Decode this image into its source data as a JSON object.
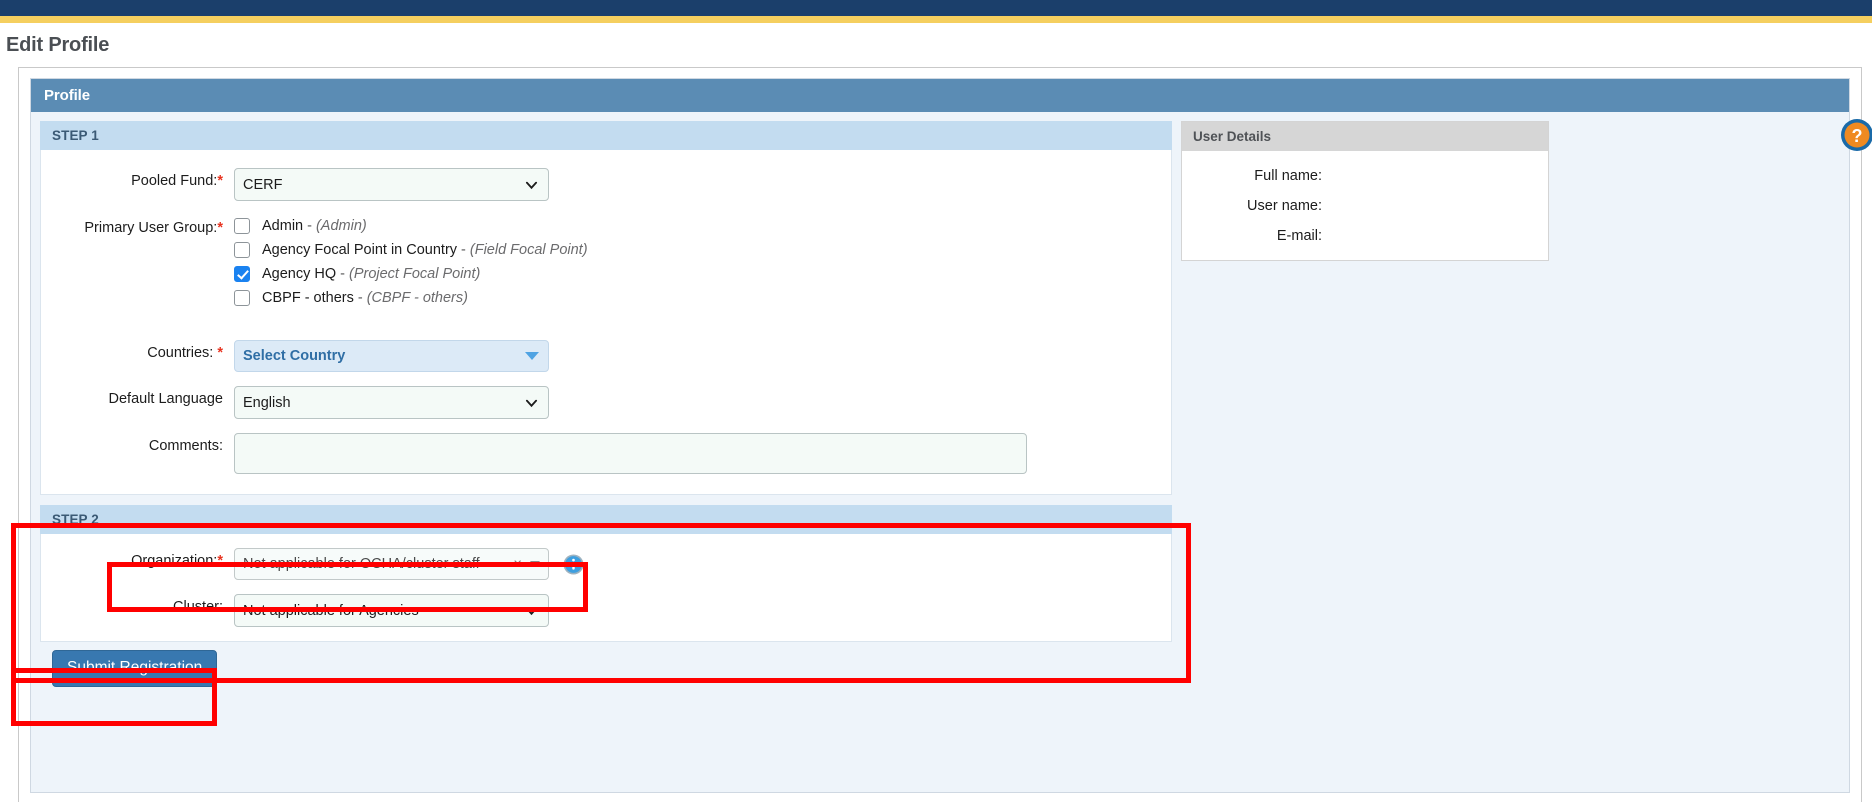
{
  "page": {
    "title": "Edit Profile"
  },
  "help": {
    "icon": "help-question-icon",
    "label": "?"
  },
  "profile_panel": {
    "header": "Profile"
  },
  "step1": {
    "header": "STEP 1",
    "pooled_fund": {
      "label": "Pooled Fund:",
      "required": "*",
      "value": "CERF",
      "options": [
        "CERF"
      ]
    },
    "primary_user_group": {
      "label": "Primary User Group:",
      "required": "*",
      "items": [
        {
          "name": "Admin",
          "dash": "-",
          "role": "(Admin)",
          "checked": false
        },
        {
          "name": "Agency Focal Point in Country",
          "dash": "-",
          "role": "(Field Focal Point)",
          "checked": false
        },
        {
          "name": "Agency HQ",
          "dash": "-",
          "role": "(Project Focal Point)",
          "checked": true
        },
        {
          "name": "CBPF - others",
          "dash": "-",
          "role": "(CBPF - others)",
          "checked": false
        }
      ]
    },
    "countries": {
      "label": "Countries:",
      "required": "*",
      "placeholder": "Select Country",
      "value": ""
    },
    "default_language": {
      "label": "Default Language",
      "value": "English",
      "options": [
        "English"
      ]
    },
    "comments": {
      "label": "Comments:",
      "value": "",
      "placeholder": ""
    }
  },
  "step2": {
    "header": "STEP 2",
    "organization": {
      "label": "Organization:",
      "required": "*",
      "value": "Not applicable for OCHA/cluster staff",
      "clear_glyph": "×",
      "info_icon": "info-icon"
    },
    "cluster": {
      "label": "Cluster:",
      "value": "Not applicable for Agencies",
      "options": [
        "Not applicable for Agencies"
      ]
    }
  },
  "user_details": {
    "header": "User Details",
    "rows": [
      {
        "label": "Full name:",
        "value": ""
      },
      {
        "label": "User name:",
        "value": ""
      },
      {
        "label": "E-mail:",
        "value": ""
      }
    ]
  },
  "actions": {
    "submit_label": "Submit Registration"
  },
  "colors": {
    "top_bar_navy": "#1b3f6b",
    "top_bar_yellow": "#f5cf5f",
    "panel_header_blue": "#5b8cb4",
    "step_header_blue": "#c3dcf0",
    "accent_checkbox": "#1a82f0",
    "required_red": "#e8321e",
    "annotation_red": "#ff0000",
    "submit_blue": "#3878b0",
    "help_orange": "#ef8a21"
  }
}
